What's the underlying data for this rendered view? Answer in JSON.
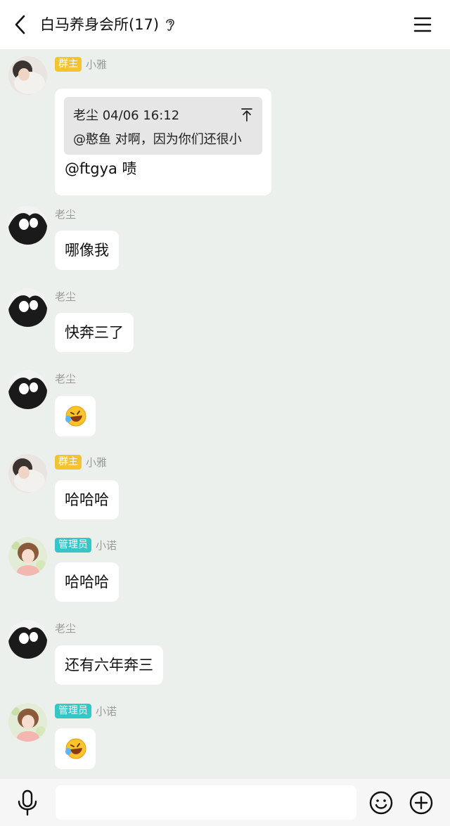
{
  "header": {
    "title": "白马养身会所(17)",
    "icons": [
      "back-icon",
      "ear-icon",
      "menu-icon"
    ]
  },
  "messages": [
    {
      "sender": "小雅",
      "badge": "群主",
      "avatar": "avatar-xiaoya",
      "quote": {
        "head": "老尘 04/06 16:12",
        "text": "@憨鱼 对啊，因为你们还很小",
        "icon": "pin-icon"
      },
      "text": "@ftgya 啧"
    },
    {
      "sender": "老尘",
      "badge": "",
      "avatar": "avatar-laochen",
      "text": "哪像我"
    },
    {
      "sender": "老尘",
      "badge": "",
      "avatar": "avatar-laochen",
      "text": "快奔三了"
    },
    {
      "sender": "老尘",
      "badge": "",
      "avatar": "avatar-laochen",
      "emoji": "laughing-tears-emoji"
    },
    {
      "sender": "小雅",
      "badge": "群主",
      "avatar": "avatar-xiaoya",
      "text": "哈哈哈"
    },
    {
      "sender": "小诺",
      "badge": "管理员",
      "avatar": "avatar-xiaonuo",
      "text": "哈哈哈"
    },
    {
      "sender": "老尘",
      "badge": "",
      "avatar": "avatar-laochen",
      "text": "还有六年奔三"
    },
    {
      "sender": "小诺",
      "badge": "管理员",
      "avatar": "avatar-xiaonuo",
      "emoji": "laughing-tears-emoji"
    }
  ],
  "input_bar": {
    "placeholder": "",
    "icons": [
      "mic-icon",
      "emoji-icon",
      "plus-icon"
    ]
  },
  "colors": {
    "chat_background": "#ecf0ec",
    "owner_badge": "#f6c330",
    "admin_badge": "#35c6c9",
    "sender_name": "#9a9a9a"
  }
}
